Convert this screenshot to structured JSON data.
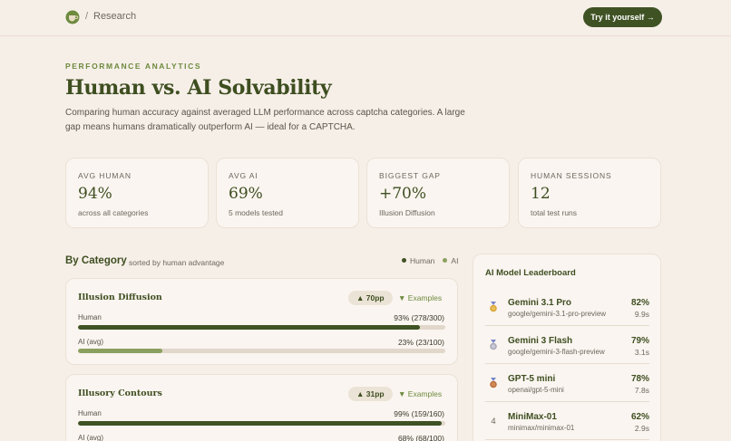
{
  "header": {
    "crumb_sep": "/",
    "crumb": "Research",
    "cta_label": "Try it yourself →"
  },
  "hero": {
    "eyebrow": "PERFORMANCE ANALYTICS",
    "title": "Human vs. AI Solvability",
    "subtitle": "Comparing human accuracy against averaged LLM performance across captcha categories. A large gap means humans dramatically outperform AI — ideal for a CAPTCHA."
  },
  "stats": [
    {
      "label": "AVG HUMAN",
      "value": "94%",
      "sub": "across all categories"
    },
    {
      "label": "AVG AI",
      "value": "69%",
      "sub": "5 models tested"
    },
    {
      "label": "BIGGEST GAP",
      "value": "+70%",
      "sub": "Illusion Diffusion"
    },
    {
      "label": "HUMAN SESSIONS",
      "value": "12",
      "sub": "total test runs"
    }
  ],
  "category_section": {
    "title": "By Category",
    "note": "sorted by human advantage",
    "legend_human": "Human",
    "legend_ai": "AI"
  },
  "categories": [
    {
      "name": "Illusion Diffusion",
      "badge": "▲ 70pp",
      "examples": "▼ Examples",
      "human_label": "Human",
      "human_value": "93% (278/300)",
      "human_pct": 93,
      "ai_label": "AI (avg)",
      "ai_value": "23% (23/100)",
      "ai_pct": 23
    },
    {
      "name": "Illusory Contours",
      "badge": "▲ 31pp",
      "examples": "▼ Examples",
      "human_label": "Human",
      "human_value": "99% (159/160)",
      "human_pct": 99,
      "ai_label": "AI (avg)",
      "ai_value": "68% (68/100)",
      "ai_pct": 68
    }
  ],
  "leaderboard": {
    "title": "AI Model Leaderboard",
    "models": [
      {
        "rank": "🥇",
        "name": "Gemini 3.1 Pro",
        "id": "google/gemini-3.1-pro-preview",
        "pct": "82%",
        "time": "9.9s"
      },
      {
        "rank": "🥈",
        "name": "Gemini 3 Flash",
        "id": "google/gemini-3-flash-preview",
        "pct": "79%",
        "time": "3.1s"
      },
      {
        "rank": "🥉",
        "name": "GPT-5 mini",
        "id": "openai/gpt-5-mini",
        "pct": "78%",
        "time": "7.8s"
      },
      {
        "rank": "4",
        "name": "MiniMax-01",
        "id": "minimax/minimax-01",
        "pct": "62%",
        "time": "2.9s"
      }
    ]
  },
  "colors": {
    "accent": "#3f5224",
    "human_bar": "#3f5224",
    "ai_bar": "#8aa05e",
    "background": "#f6efe8"
  }
}
